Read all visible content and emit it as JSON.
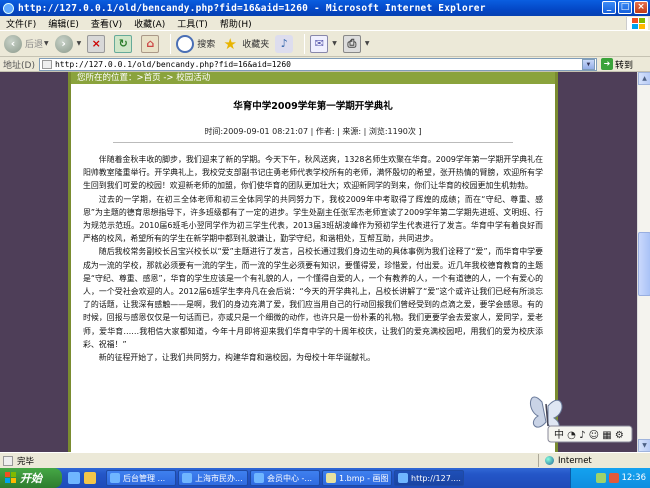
{
  "window": {
    "title": "http://127.0.0.1/old/bencandy.php?fid=16&aid=1260 - Microsoft Internet Explorer",
    "controls": [
      "_",
      "□",
      "×"
    ]
  },
  "menu": [
    "文件(F)",
    "编辑(E)",
    "查看(V)",
    "收藏(A)",
    "工具(T)",
    "帮助(H)"
  ],
  "toolbar": {
    "back": "后退",
    "search": "搜索",
    "favorites": "收藏夹"
  },
  "address": {
    "label": "地址(D)",
    "url": "http://127.0.0.1/old/bencandy.php?fid=16&aid=1260",
    "go": "转到"
  },
  "page": {
    "location": "您所在的位置：>首页 -> 校园活动",
    "title": "华育中学2009学年第一学期开学典礼",
    "meta": "时间:2009-09-01 08:21:07 | 作者: | 来源: | 浏览:1190次 ]",
    "paragraphs": [
      "伴随着金秋丰收的脚步，我们迎来了新的学期。今天下午，秋风送爽，1328名师生欢聚在华育。2009学年第一学期开学典礼在阳帅教室隆重举行。开学典礼上，我校党支部副书记庄勇老师代表学校所有的老师，满怀殷切的希望，张开热情的臂膀，欢迎所有学生回到我们可爱的校园！欢迎新老师的加盟，你们使华育的团队更加壮大；欢迎新同学的到来，你们让华育的校园更加生机勃勃。",
      "过去的一学期，在初三全体老师和初三全体同学的共同努力下，我校2009年中考取得了辉煌的成绩；而在“守纪、尊重、感恩”为主题的德育思想指导下，许多班级都有了一定的进步。学生处副主任张军杰老师宣读了2009学年第二学期先进班、文明班、行为规范示范班。2010届6班毛小翌同学作为初三学生代表，2013届3班胡凌峰作为预初学生代表进行了发言。华育中学有着良好而严格的校风，希望所有的学生在新学期中都到礼貌谦让，勤学守纪，和谐相处，互帮互助，共同进步。",
      "随后我校常务副校长吕宝兴校长以“爱”主题进行了发言，吕校长通过我们身边生动的具体事例为我们诠释了“爱”，而华育中学要成为一流的学校，那就必须要有一流的学生，而一流的学生必须要有知识，要懂得爱，珍惜爱，付出爱。近几年我校德育教育的主题是“守纪、尊重、感恩”，华育的学生应该是一个有礼貌的人，一个懂得自爱的人，一个有教养的人，一个有道德的人，一个有爱心的人，一个受社会欢迎的人。2012届6班学生李舟凡在会后说：“今天的开学典礼上，吕校长讲解了“爱”这个或许让我们已经有所淡忘了的话题，让我深有感触——是啊，我们的身边充满了爱，我们应当用自己的行动回报我们曾经受到的点滴之爱，要学会感恩。有的时候，回报与感恩仅仅是一句话而已，亦或只是一个细微的动作，也许只是一份朴素的礼物。我们更要学会去爱家人，爱同学，爱老师，爱华育……我相信大家都知道，今年十月即将迎来我们华育中学的十周年校庆，让我们的爱充满校园吧，用我们的爱为校庆添彩、祝福！”",
      "新的征程开始了，让我们共同努力，构建华育和谐校园，为母校十年华诞献礼。"
    ]
  },
  "status": {
    "left": "完毕",
    "zone": "Internet"
  },
  "taskbar": {
    "start": "开始",
    "tasks": [
      "后台管理 ...",
      "上海市民办...",
      "会员中心 -...",
      "1.bmp - 画图",
      "http://127...."
    ],
    "clock": "12:36"
  },
  "colors": {
    "titlebar": "#0a5ee0",
    "location_bar": "#8aa33c",
    "side_bg": "#4e3e58",
    "page_border": "#7a8c30"
  }
}
